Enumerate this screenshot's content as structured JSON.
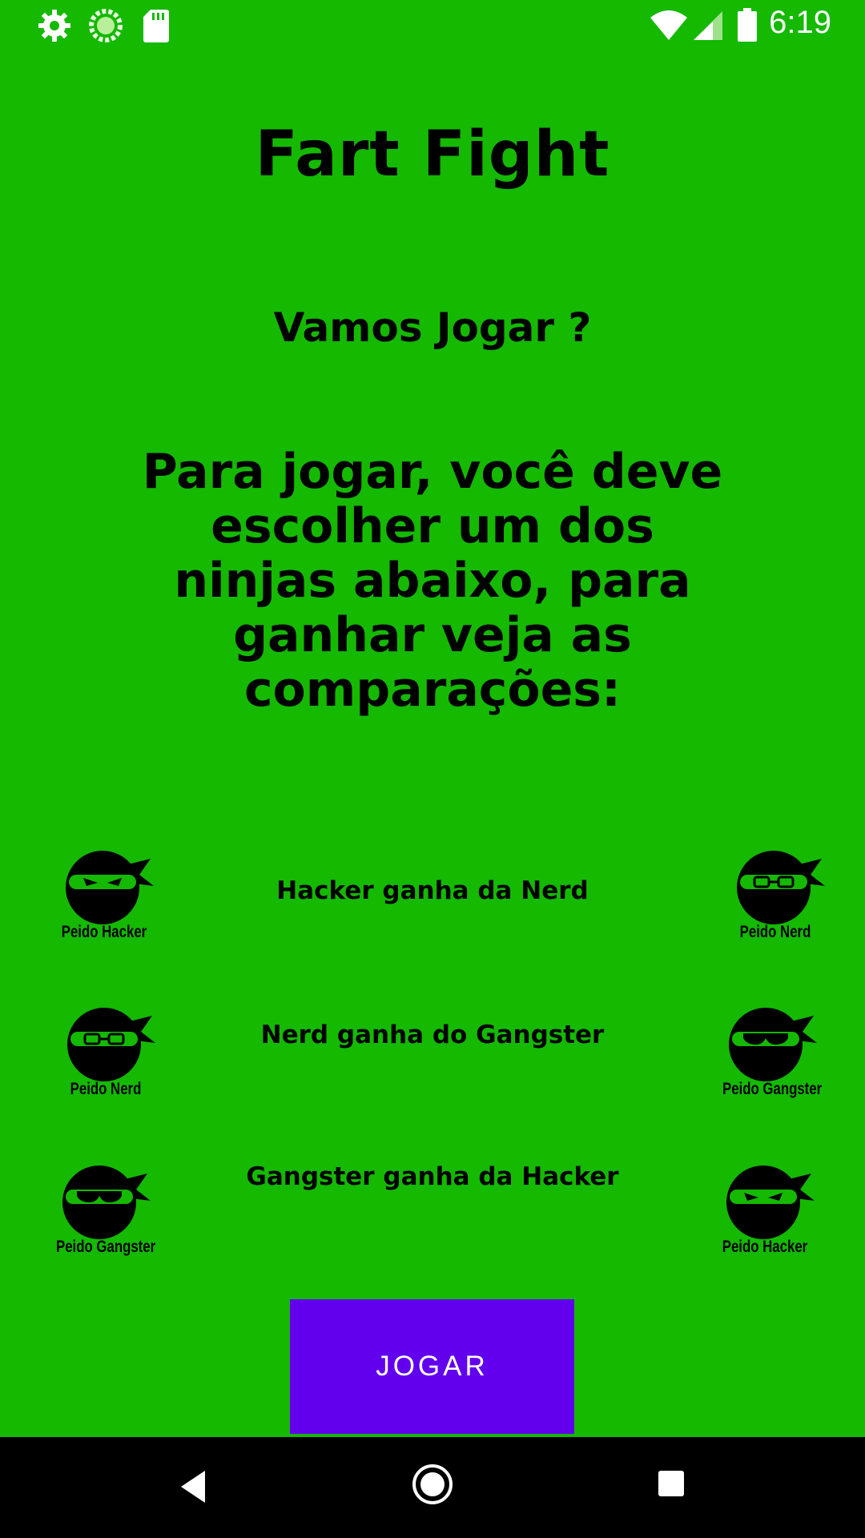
{
  "status_bar": {
    "time": "6:19",
    "left_icons": [
      "settings-icon",
      "loading-icon",
      "sd-card-icon"
    ],
    "right_icons": [
      "wifi-icon",
      "signal-icon",
      "battery-icon"
    ]
  },
  "app": {
    "title": "Fart Fight",
    "subtitle": "Vamos Jogar ?",
    "instructions": "Para jogar,  você deve escolher um dos ninjas abaixo, para ganhar veja as comparações:"
  },
  "matchups": [
    {
      "left_label": "Peido Hacker",
      "rule": "Hacker ganha da Nerd",
      "right_label": "Peido Nerd"
    },
    {
      "left_label": "Peido Nerd",
      "rule": "Nerd ganha do Gangster",
      "right_label": "Peido Gangster"
    },
    {
      "left_label": "Peido Gangster",
      "rule": "Gangster ganha da Hacker",
      "right_label": "Peido Hacker"
    }
  ],
  "play_button": {
    "label": "JOGAR"
  },
  "colors": {
    "background": "#14b900",
    "button": "#6200ee",
    "nav_bar": "#000000"
  },
  "nav_bar": {
    "icons": [
      "back-icon",
      "home-icon",
      "recents-icon"
    ]
  }
}
